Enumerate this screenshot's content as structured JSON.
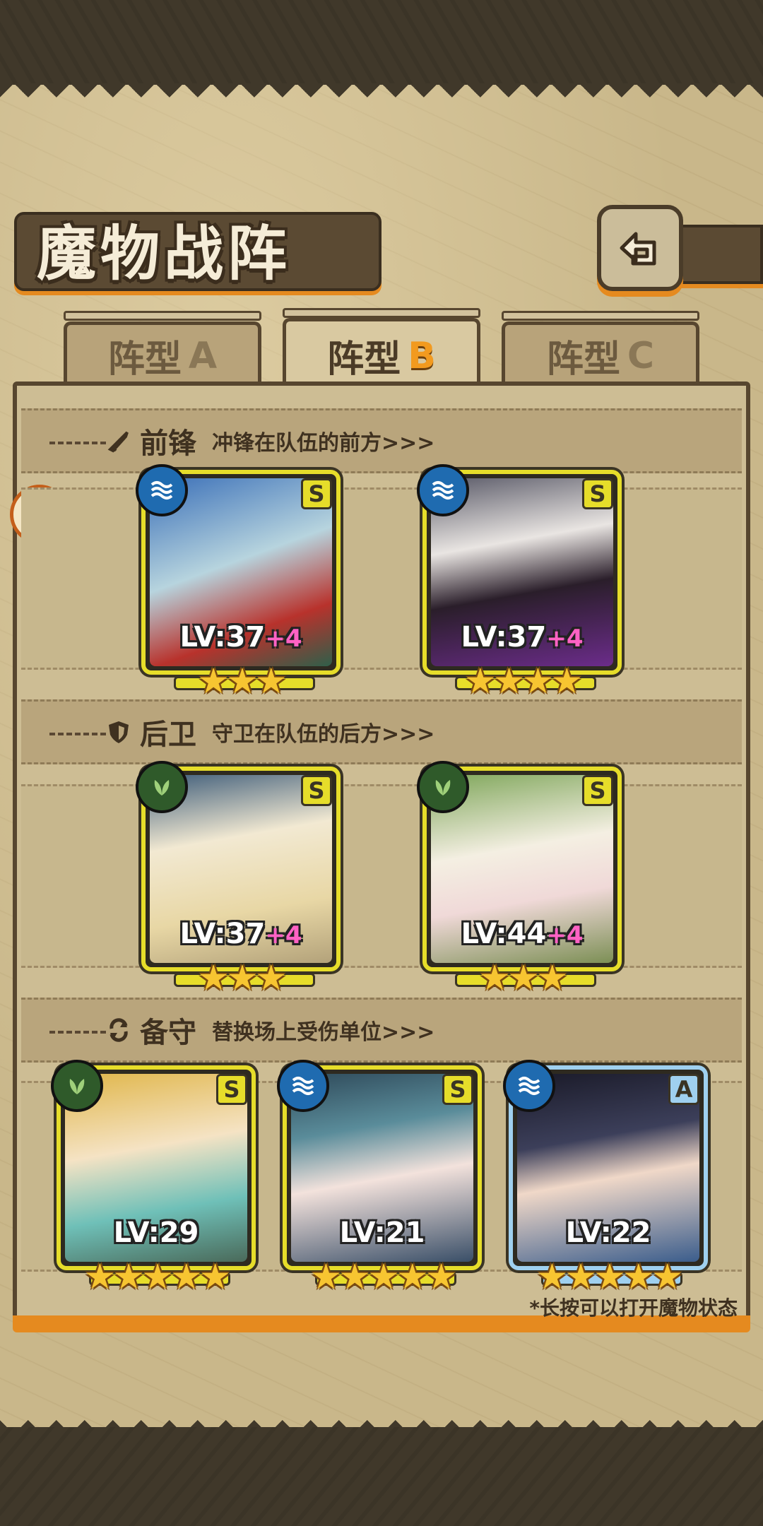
{
  "header": {
    "title": "魔物战阵"
  },
  "tabs": [
    {
      "label": "阵型",
      "letter": "A",
      "active": false
    },
    {
      "label": "阵型",
      "letter": "B",
      "active": true
    },
    {
      "label": "阵型",
      "letter": "C",
      "active": false
    }
  ],
  "sections": {
    "front": {
      "title": "前锋",
      "desc": "冲锋在队伍的前方>>>"
    },
    "rear": {
      "title": "后卫",
      "desc": "守卫在队伍的后方>>>"
    },
    "reserve": {
      "title": "备守",
      "desc": "替换场上受伤单位>>>"
    }
  },
  "cards": {
    "front": [
      {
        "element": "water-icon",
        "rank": "S",
        "level": "LV:37",
        "plus": "+4",
        "stars": "★★★",
        "art_color": "#b7d4de"
      },
      {
        "element": "water-icon",
        "rank": "S",
        "level": "LV:37",
        "plus": "+4",
        "stars": "★★★★",
        "art_color": "#8f8f98"
      }
    ],
    "rear": [
      {
        "element": "leaf-icon",
        "rank": "S",
        "level": "LV:37",
        "plus": "+4",
        "stars": "★★★",
        "art_color": "#e9dcb6"
      },
      {
        "element": "leaf-icon",
        "rank": "S",
        "level": "LV:44",
        "plus": "+4",
        "stars": "★★★",
        "art_color": "#cfd9b2"
      }
    ],
    "reserve": [
      {
        "element": "leaf-icon",
        "rank": "S",
        "level": "LV:29",
        "plus": "",
        "stars": "★★★★★",
        "art_color": "#e7d6a0"
      },
      {
        "element": "water-icon",
        "rank": "S",
        "level": "LV:21",
        "plus": "",
        "stars": "★★★★★",
        "art_color": "#8fb0bd"
      },
      {
        "element": "water-icon",
        "rank": "A",
        "level": "LV:22",
        "plus": "",
        "stars": "★★★★★",
        "art_color": "#7f8fa8"
      }
    ]
  },
  "hint": "*长按可以打开魔物状态"
}
